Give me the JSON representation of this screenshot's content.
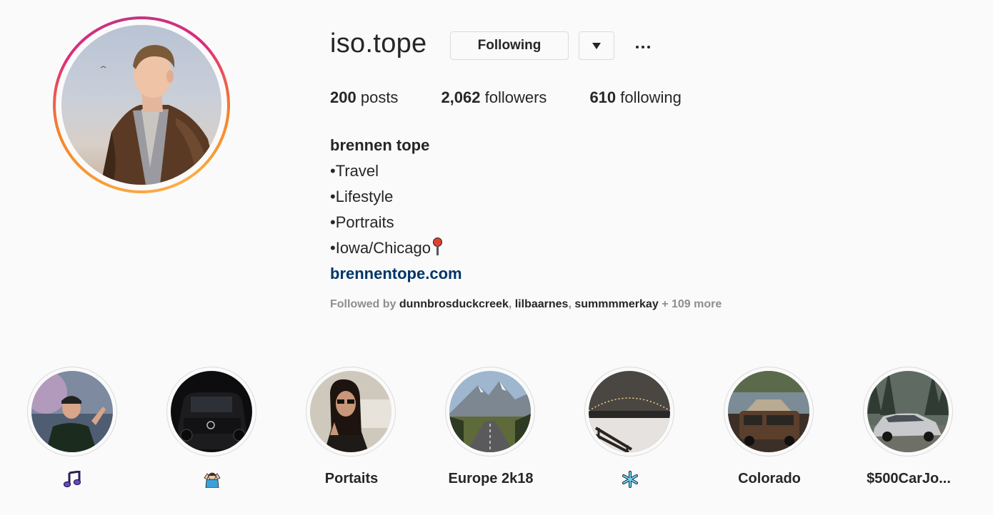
{
  "profile": {
    "username": "iso.tope",
    "following_button": "Following",
    "stats": {
      "posts_count": "200",
      "posts_label": "posts",
      "followers_count": "2,062",
      "followers_label": "followers",
      "following_count": "610",
      "following_label": "following"
    },
    "bio": {
      "name": "brennen tope",
      "lines": [
        "•Travel",
        "•Lifestyle",
        "•Portraits",
        "•Iowa/Chicago"
      ],
      "link": "brennentope.com"
    },
    "followed_by": {
      "prefix": "Followed by",
      "accounts": [
        "dunnbrosduckcreek",
        "lilbaarnes",
        "summmmerkay"
      ],
      "more": "+ 109 more"
    }
  },
  "highlights": [
    {
      "label": "",
      "icon": "musical-notes-icon"
    },
    {
      "label": "",
      "icon": "person-shrugging-icon"
    },
    {
      "label": "Portaits"
    },
    {
      "label": "Europe 2k18"
    },
    {
      "label": "",
      "icon": "snowflake-icon"
    },
    {
      "label": "Colorado"
    },
    {
      "label": "$500CarJo..."
    }
  ],
  "colors": {
    "link": "#003569",
    "muted": "#8e8e8e",
    "text": "#262626",
    "border": "#dbdbdb"
  }
}
